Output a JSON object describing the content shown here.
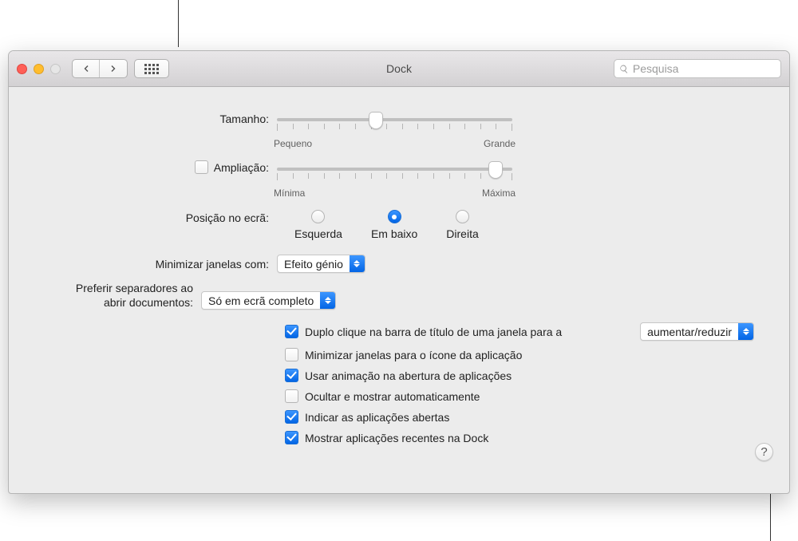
{
  "window": {
    "title": "Dock"
  },
  "toolbar": {
    "search_placeholder": "Pesquisa"
  },
  "size": {
    "label": "Tamanho:",
    "min_label": "Pequeno",
    "max_label": "Grande",
    "value_percent": 42
  },
  "magnification": {
    "label": "Ampliação:",
    "enabled": false,
    "min_label": "Mínima",
    "max_label": "Máxima",
    "value_percent": 93
  },
  "position": {
    "label": "Posição no ecrã:",
    "options": {
      "left": "Esquerda",
      "bottom": "Em baixo",
      "right": "Direita"
    },
    "selected": "bottom"
  },
  "minimize_effect": {
    "label": "Minimizar janelas com:",
    "value": "Efeito génio"
  },
  "prefer_tabs": {
    "label": "Preferir separadores ao\nabrir documentos:",
    "label_line1": "Preferir separadores ao",
    "label_line2": "abrir documentos:",
    "value": "Só em ecrã completo"
  },
  "checkboxes": {
    "double_click": {
      "checked": true,
      "label": "Duplo clique na barra de título de uma janela para a",
      "popup_value": "aumentar/reduzir"
    },
    "minimize_into_icon": {
      "checked": false,
      "label": "Minimizar janelas para o ícone da aplicação"
    },
    "animate_open": {
      "checked": true,
      "label": "Usar animação na abertura de aplicações"
    },
    "autohide": {
      "checked": false,
      "label": "Ocultar e mostrar automaticamente"
    },
    "show_indicators": {
      "checked": true,
      "label": "Indicar as aplicações abertas"
    },
    "show_recents": {
      "checked": true,
      "label": "Mostrar aplicações recentes na Dock"
    }
  },
  "help": {
    "glyph": "?"
  }
}
